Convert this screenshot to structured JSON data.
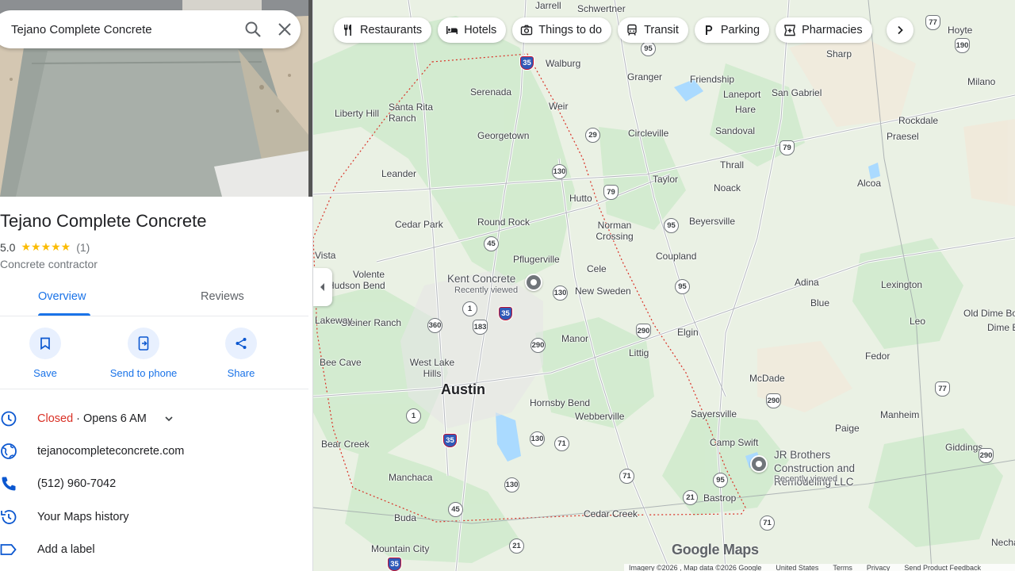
{
  "search": {
    "value": "Tejano Complete Concrete"
  },
  "place": {
    "title": "Tejano Complete Concrete",
    "rating": "5.0",
    "stars": "★★★★★",
    "review_count": "(1)",
    "category": "Concrete contractor"
  },
  "tabs": [
    {
      "label": "Overview"
    },
    {
      "label": "Reviews"
    }
  ],
  "actions": [
    {
      "label": "Save"
    },
    {
      "label": "Send to phone"
    },
    {
      "label": "Share"
    }
  ],
  "hours": {
    "status": "Closed",
    "opens": " · Opens 6 AM"
  },
  "website": "tejanocompleteconcrete.com",
  "phone": "(512) 960-7042",
  "history": "Your Maps history",
  "add_label": "Add a label",
  "chips": [
    {
      "label": "Restaurants",
      "icon": "fork-knife-icon"
    },
    {
      "label": "Hotels",
      "icon": "bed-icon"
    },
    {
      "label": "Things to do",
      "icon": "camera-icon"
    },
    {
      "label": "Transit",
      "icon": "train-icon"
    },
    {
      "label": "Parking",
      "icon": "parking-icon"
    },
    {
      "label": "Pharmacies",
      "icon": "pharmacy-icon"
    }
  ],
  "map": {
    "places": [
      "Jarrell",
      "Schwertner",
      "Walburg",
      "Granger",
      "Friendship",
      "Sharp",
      "Hoyte",
      "Milano",
      "Serenada",
      "Santa Rita Ranch",
      "Weir",
      "Liberty Hill",
      "Laneport",
      "San Gabriel",
      "Hare",
      "Georgetown",
      "Circleville",
      "Sandoval",
      "Rockdale",
      "Praesel",
      "Thrall",
      "Leander",
      "Hutto",
      "Taylor",
      "Noack",
      "Alcoa",
      "Cedar Park",
      "Round Rock",
      "Norman Crossing",
      "Beyersville",
      "Coupland",
      "Pflugerville",
      "Cele",
      "New Sweden",
      "Volente",
      "Hudson Bend",
      "Adina",
      "Lexington",
      "Blue",
      "Steiner Ranch",
      "Old Dime Box",
      "Dime Box",
      "Leo",
      "Elgin",
      "Manor",
      "Littig",
      "Fedor",
      "Bee Cave",
      "West Lake Hills",
      "Austin",
      "McDade",
      "Hornsby Bend",
      "Webberville",
      "Sayersville",
      "Manheim",
      "Paige",
      "Camp Swift",
      "Giddings",
      "Bear Creek",
      "Manchaca",
      "Bastrop",
      "Buda",
      "Cedar Creek",
      "Mountain City",
      "Nechanitz",
      "Vista",
      "Lakeway"
    ],
    "pois": [
      {
        "name": "Kent Concrete",
        "note": "Recently viewed"
      },
      {
        "name": "JR Brothers Construction and Remodeling LLC",
        "note": "Recently viewed"
      }
    ],
    "shields": [
      "35",
      "95",
      "29",
      "130",
      "79",
      "77",
      "190",
      "79",
      "45",
      "95",
      "130",
      "1",
      "183",
      "35",
      "360",
      "290",
      "290",
      "95",
      "1",
      "35",
      "130",
      "71",
      "71",
      "130",
      "21",
      "95",
      "45",
      "71",
      "21",
      "35",
      "77",
      "290",
      "290"
    ],
    "watermark": "Google Maps",
    "footer": [
      "Imagery ©2026 , Map data ©2026 Google",
      "United States",
      "Terms",
      "Privacy",
      "Send Product Feedback"
    ]
  },
  "colors": {
    "accent": "#1a73e8",
    "closed": "#d93025",
    "star": "#fbbc04",
    "park": "#c8e6c9",
    "water": "#aadaff"
  }
}
